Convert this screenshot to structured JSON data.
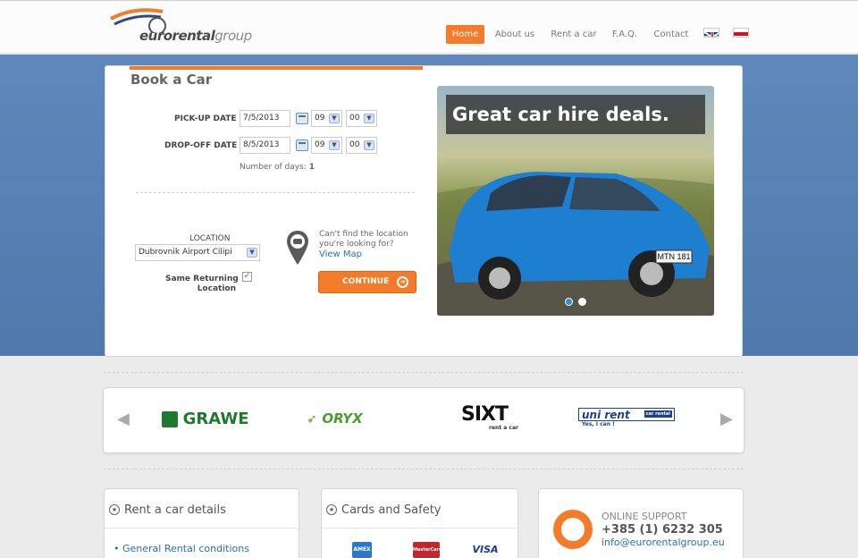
{
  "brand": {
    "logo_main": "eurorental",
    "logo_accent": "group"
  },
  "nav": {
    "items": [
      "Home",
      "About us",
      "Rent a car",
      "F.A.Q.",
      "Contact"
    ],
    "active": "Home",
    "flags": [
      "english-flag",
      "croatian-flag"
    ]
  },
  "booking": {
    "title": "Book a Car",
    "pickup_label": "PICK-UP DATE",
    "pickup_date": "7/5/2013",
    "pickup_hour": "09",
    "pickup_minute": "00",
    "dropoff_label": "DROP-OFF DATE",
    "dropoff_date": "8/5/2013",
    "dropoff_hour": "09",
    "dropoff_minute": "00",
    "days_label": "Number of days:",
    "days_value": "1",
    "location_label": "LOCATION",
    "location_value": "Dubrovnik Airport Cilipi",
    "same_return_label_line1": "Same Returning",
    "same_return_label_line2": "Location",
    "same_return_checked": true,
    "cant_find": "Can't find the location you're looking for?",
    "view_map": "View Map",
    "continue": "CONTINUE"
  },
  "slider": {
    "caption": "Great car hire deals.",
    "plate": "MTN 181",
    "slides": 2,
    "current": 1
  },
  "partners": [
    {
      "name": "GRAWE",
      "color": "#1e7a2e"
    },
    {
      "name": "ORYX",
      "color": "#4aa02c"
    },
    {
      "name": "SIXT",
      "sub": "rent a car",
      "color": "#111111"
    },
    {
      "name": "uni rent",
      "tag": "car rental",
      "sub": "Yes, I can !",
      "color": "#1c3f94"
    }
  ],
  "boxes": {
    "rent_details": {
      "title": "Rent a car details",
      "link": "General Rental conditions"
    },
    "cards": {
      "title": "Cards and Safety",
      "cards": [
        "AMEX",
        "MasterCard",
        "VISA"
      ]
    },
    "support": {
      "title": "ONLINE SUPPORT",
      "phone": "+385 (1) 6232 305",
      "email": "info@eurorentalgroup.eu"
    }
  },
  "colors": {
    "accent": "#f47b2a",
    "link": "#2b6fb3",
    "hero": "#5b82b5"
  }
}
